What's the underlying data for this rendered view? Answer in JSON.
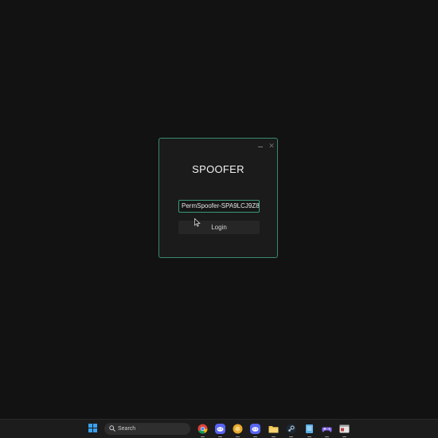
{
  "window": {
    "title": "SPOOFER",
    "license_value": "PermSpoofer-SPA9LCJ9Z8",
    "login_label": "Login",
    "minimize_icon": "minimize-icon",
    "close_icon": "close-icon",
    "close_glyph": "✕"
  },
  "taskbar": {
    "search_label": "Search",
    "apps": [
      {
        "name": "chrome-icon"
      },
      {
        "name": "discord-icon"
      },
      {
        "name": "yellow-app-icon"
      },
      {
        "name": "discord-icon"
      },
      {
        "name": "file-explorer-icon"
      },
      {
        "name": "steam-icon"
      },
      {
        "name": "notepad-icon"
      },
      {
        "name": "game-controller-icon"
      },
      {
        "name": "app-window-icon"
      }
    ]
  },
  "colors": {
    "accent": "#3a9a78",
    "background": "#121212",
    "window_bg": "#1b1b1b"
  }
}
